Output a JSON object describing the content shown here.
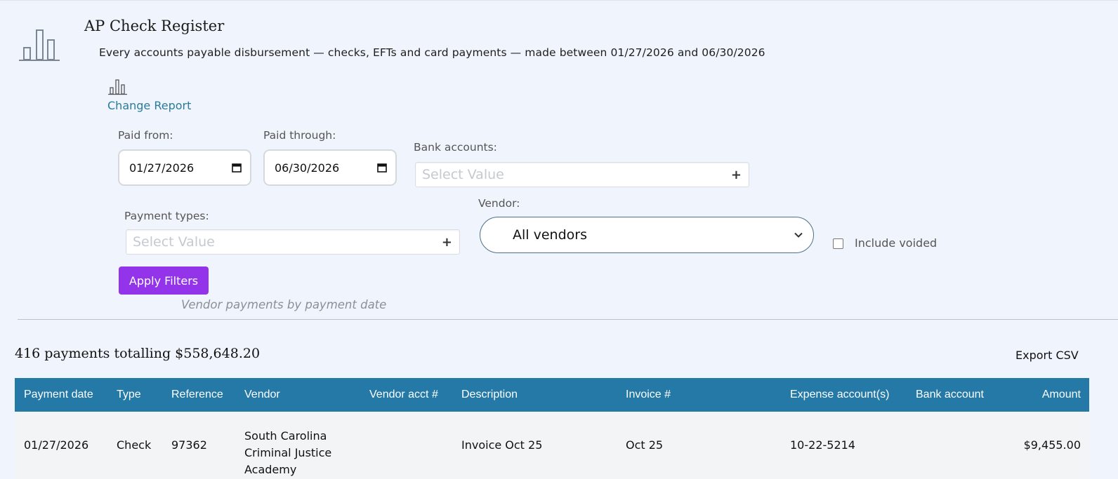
{
  "report": {
    "title": "AP Check Register",
    "subtitle": "Every accounts payable disbursement — checks, EFTs and card payments — made between 01/27/2026 and 06/30/2026",
    "change_report_label": "Change Report"
  },
  "filters": {
    "paid_from_label": "Paid from:",
    "paid_from_value": "01/27/2026",
    "paid_through_label": "Paid through:",
    "paid_through_value": "06/30/2026",
    "bank_accounts_label": "Bank accounts:",
    "bank_accounts_placeholder": "Select Value",
    "payment_types_label": "Payment types:",
    "payment_types_placeholder": "Select Value",
    "vendor_label": "Vendor:",
    "vendor_value": "All vendors",
    "include_voided_label": "Include voided",
    "include_voided_checked": false,
    "apply_label": "Apply Filters",
    "caption": "Vendor payments by payment date"
  },
  "summary": {
    "text": "416 payments totalling $558,648.20",
    "export_label": "Export CSV"
  },
  "table": {
    "headers": [
      "Payment date",
      "Type",
      "Reference",
      "Vendor",
      "Vendor acct #",
      "Description",
      "Invoice #",
      "Expense account(s)",
      "Bank account",
      "Amount"
    ],
    "rows": [
      {
        "payment_date": "01/27/2026",
        "type": "Check",
        "reference": "97362",
        "vendor": "South Carolina Criminal Justice Academy",
        "vendor_acct": "",
        "description": "Invoice Oct 25",
        "invoice": "Oct 25",
        "expense_accounts": "10-22-5214",
        "bank_account": "",
        "amount": "$9,455.00"
      }
    ]
  },
  "colors": {
    "header_bg": "#2479a7",
    "apply_button": "#9333ea",
    "link": "#2a7aa0",
    "page_bg": "#f0f5fd"
  },
  "icons": [
    "bar-chart-icon",
    "calendar-icon",
    "plus-icon",
    "chevron-down-icon"
  ]
}
